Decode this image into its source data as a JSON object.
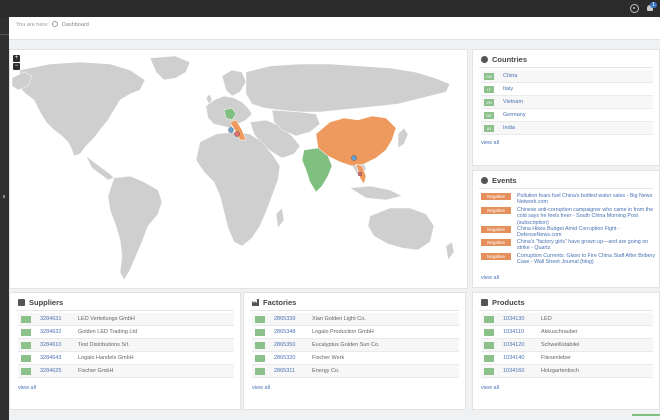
{
  "header": {
    "notification_count": "1",
    "icons": [
      "gear-icon",
      "bell-icon"
    ]
  },
  "breadcrumb": {
    "prefix": "You are here:",
    "current": "Dashboard"
  },
  "map": {
    "zoom_in": "+",
    "zoom_out": "−",
    "highlight_color": "#ee9a5e",
    "green_color": "#7fbf7f"
  },
  "countries": {
    "title": "Countries",
    "items": [
      {
        "code": "CN",
        "name": "China"
      },
      {
        "code": "IT",
        "name": "Italy"
      },
      {
        "code": "VN",
        "name": "Vietnam"
      },
      {
        "code": "DE",
        "name": "Germany"
      },
      {
        "code": "IN",
        "name": "India"
      }
    ],
    "view_all": "view all"
  },
  "events": {
    "title": "Events",
    "items": [
      {
        "badge": "Negative",
        "text": "Pollution fears fuel China's bottled water sales - Big News Network.com"
      },
      {
        "badge": "Negative",
        "text": "Chinese anti-corruption campaigner who came in from the cold says he feels freer - South China Morning Post (subscription)"
      },
      {
        "badge": "Negative",
        "text": "China Hikes Budget Amid Corruption Fight - DefenseNews.com"
      },
      {
        "badge": "Negative",
        "text": "China's \"factory girls\" have grown up—and are going on strike - Quartz"
      },
      {
        "badge": "Negative",
        "text": "Corruption Currents: Glaxo to Fire China Staff After Bribery Case - Wall Street Journal (blog)"
      }
    ],
    "view_all": "view all"
  },
  "suppliers": {
    "title": "Suppliers",
    "rows": [
      {
        "code": "3284631",
        "name": "LED Verteilungs GmbH"
      },
      {
        "code": "3284632",
        "name": "Golden LED Trading Ltd"
      },
      {
        "code": "3284610",
        "name": "Test Distributions Srl."
      },
      {
        "code": "3284643",
        "name": "Logalo Handels GmbH"
      },
      {
        "code": "3284625",
        "name": "Fischer GmbH"
      }
    ],
    "view_all": "view all"
  },
  "factories": {
    "title": "Factories",
    "rows": [
      {
        "code": "2865339",
        "name": "Xian Golden Light Co."
      },
      {
        "code": "2865348",
        "name": "Logalo Production GmbH"
      },
      {
        "code": "2865350",
        "name": "Eucalyptus Golden Sun Co."
      },
      {
        "code": "2865320",
        "name": "Fischer Werk"
      },
      {
        "code": "2865311",
        "name": "Energy Co."
      }
    ],
    "view_all": "view all"
  },
  "products": {
    "title": "Products",
    "rows": [
      {
        "code": "1034130",
        "name": "LED"
      },
      {
        "code": "1034110",
        "name": "Akkuschrauber"
      },
      {
        "code": "1034120",
        "name": "Schweißstabilel"
      },
      {
        "code": "1034140",
        "name": "Fliesenleber"
      },
      {
        "code": "1034160",
        "name": "Holzgartentisch"
      }
    ],
    "view_all": "view all"
  }
}
